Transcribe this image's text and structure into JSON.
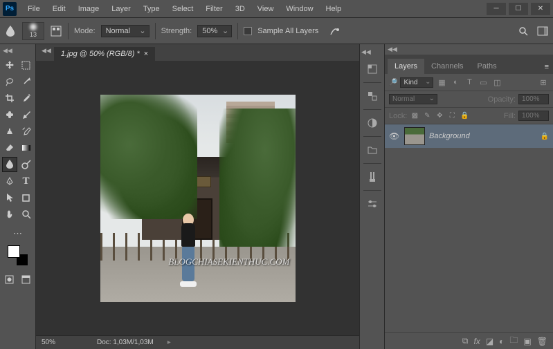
{
  "menu": [
    "File",
    "Edit",
    "Image",
    "Layer",
    "Type",
    "Select",
    "Filter",
    "3D",
    "View",
    "Window",
    "Help"
  ],
  "options": {
    "brush_size": "13",
    "mode_label": "Mode:",
    "mode_value": "Normal",
    "strength_label": "Strength:",
    "strength_value": "50%",
    "sample_all_label": "Sample All Layers"
  },
  "document": {
    "tab_title": "1.jpg @ 50% (RGB/8) *",
    "watermark": "BLOGCHIASEKIENTHUC.COM"
  },
  "status": {
    "zoom": "50%",
    "doc_label": "Doc:",
    "doc_size": "1,03M/1,03M"
  },
  "panels": {
    "tabs": {
      "layers": "Layers",
      "channels": "Channels",
      "paths": "Paths"
    },
    "kind_label": "Kind",
    "blend_mode": "Normal",
    "opacity_label": "Opacity:",
    "opacity_value": "100%",
    "lock_label": "Lock:",
    "fill_label": "Fill:",
    "fill_value": "100%",
    "layer": {
      "name": "Background"
    }
  },
  "swatches": {
    "fg": "#ffffff",
    "bg": "#000000"
  }
}
